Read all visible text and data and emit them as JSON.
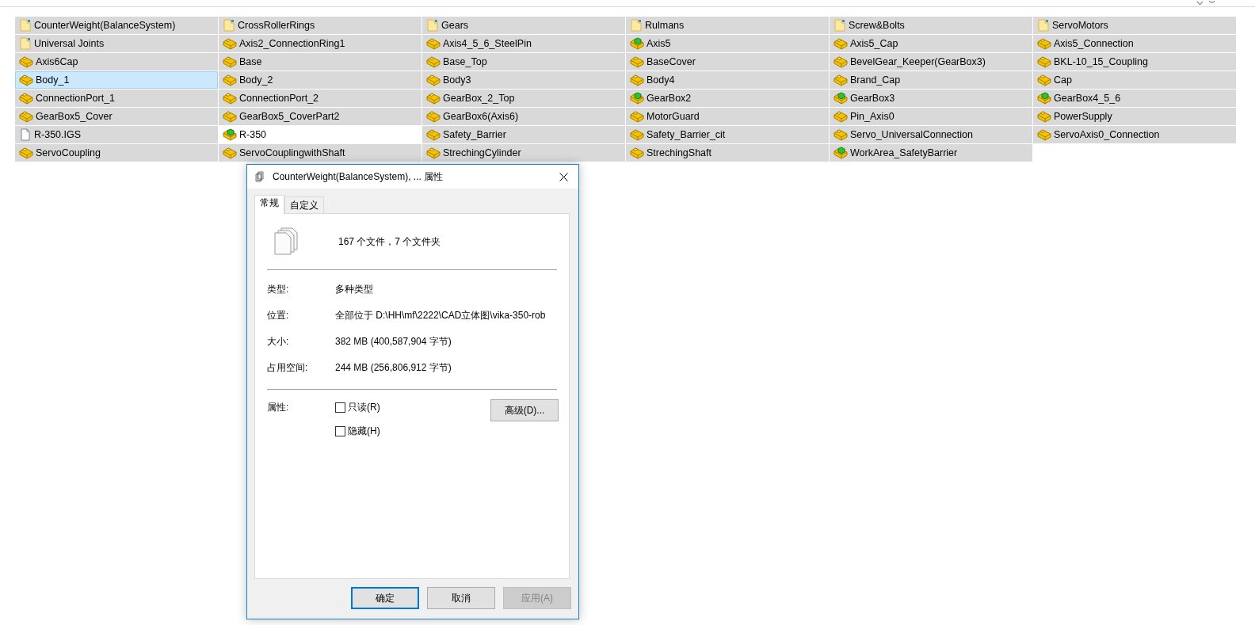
{
  "items": [
    {
      "name": "CounterWeight(BalanceSystem)",
      "kind": "folder",
      "selected": true,
      "hovered": false
    },
    {
      "name": "CrossRollerRings",
      "kind": "folder",
      "selected": true,
      "hovered": false
    },
    {
      "name": "Gears",
      "kind": "folder",
      "selected": true,
      "hovered": false
    },
    {
      "name": "Rulmans",
      "kind": "folder",
      "selected": true,
      "hovered": false
    },
    {
      "name": "Screw&Bolts",
      "kind": "folder",
      "selected": true,
      "hovered": false
    },
    {
      "name": "ServoMotors",
      "kind": "folder",
      "selected": true,
      "hovered": false
    },
    {
      "name": "Universal Joints",
      "kind": "folder",
      "selected": true,
      "hovered": false
    },
    {
      "name": "Axis2_ConnectionRing1",
      "kind": "part",
      "selected": true,
      "hovered": false
    },
    {
      "name": "Axis4_5_6_SteelPin",
      "kind": "part",
      "selected": true,
      "hovered": false
    },
    {
      "name": "Axis5",
      "kind": "assembly",
      "selected": true,
      "hovered": false
    },
    {
      "name": "Axis5_Cap",
      "kind": "part",
      "selected": true,
      "hovered": false
    },
    {
      "name": "Axis5_Connection",
      "kind": "part",
      "selected": true,
      "hovered": false
    },
    {
      "name": "Axis6Cap",
      "kind": "part",
      "selected": true,
      "hovered": false
    },
    {
      "name": "Base",
      "kind": "part",
      "selected": true,
      "hovered": false
    },
    {
      "name": "Base_Top",
      "kind": "part",
      "selected": true,
      "hovered": false
    },
    {
      "name": "BaseCover",
      "kind": "part",
      "selected": true,
      "hovered": false
    },
    {
      "name": "BevelGear_Keeper(GearBox3)",
      "kind": "part",
      "selected": true,
      "hovered": false
    },
    {
      "name": "BKL-10_15_Coupling",
      "kind": "part",
      "selected": true,
      "hovered": false
    },
    {
      "name": "Body_1",
      "kind": "part",
      "selected": true,
      "hovered": true
    },
    {
      "name": "Body_2",
      "kind": "part",
      "selected": true,
      "hovered": false
    },
    {
      "name": "Body3",
      "kind": "part",
      "selected": true,
      "hovered": false
    },
    {
      "name": "Body4",
      "kind": "part",
      "selected": true,
      "hovered": false
    },
    {
      "name": "Brand_Cap",
      "kind": "part",
      "selected": true,
      "hovered": false
    },
    {
      "name": "Cap",
      "kind": "part",
      "selected": true,
      "hovered": false
    },
    {
      "name": "ConnectionPort_1",
      "kind": "part",
      "selected": true,
      "hovered": false
    },
    {
      "name": "ConnectionPort_2",
      "kind": "part",
      "selected": true,
      "hovered": false
    },
    {
      "name": "GearBox_2_Top",
      "kind": "part",
      "selected": true,
      "hovered": false
    },
    {
      "name": "GearBox2",
      "kind": "assembly",
      "selected": true,
      "hovered": false
    },
    {
      "name": "GearBox3",
      "kind": "assembly",
      "selected": true,
      "hovered": false
    },
    {
      "name": "GearBox4_5_6",
      "kind": "assembly",
      "selected": true,
      "hovered": false
    },
    {
      "name": "GearBox5_Cover",
      "kind": "part",
      "selected": true,
      "hovered": false
    },
    {
      "name": "GearBox5_CoverPart2",
      "kind": "part",
      "selected": true,
      "hovered": false
    },
    {
      "name": "GearBox6(Axis6)",
      "kind": "part",
      "selected": true,
      "hovered": false
    },
    {
      "name": "MotorGuard",
      "kind": "part",
      "selected": true,
      "hovered": false
    },
    {
      "name": "Pin_Axis0",
      "kind": "part",
      "selected": true,
      "hovered": false
    },
    {
      "name": "PowerSupply",
      "kind": "part",
      "selected": true,
      "hovered": false
    },
    {
      "name": "R-350.IGS",
      "kind": "file",
      "selected": true,
      "hovered": false
    },
    {
      "name": "R-350",
      "kind": "assembly",
      "selected": false,
      "hovered": false
    },
    {
      "name": "Safety_Barrier",
      "kind": "part",
      "selected": true,
      "hovered": false
    },
    {
      "name": "Safety_Barrier_cit",
      "kind": "part",
      "selected": true,
      "hovered": false
    },
    {
      "name": "Servo_UniversalConnection",
      "kind": "part",
      "selected": true,
      "hovered": false
    },
    {
      "name": "ServoAxis0_Connection",
      "kind": "part",
      "selected": true,
      "hovered": false
    },
    {
      "name": "ServoCoupling",
      "kind": "part",
      "selected": true,
      "hovered": false
    },
    {
      "name": "ServoCouplingwithShaft",
      "kind": "part",
      "selected": true,
      "hovered": false
    },
    {
      "name": "StrechingCylinder",
      "kind": "part",
      "selected": true,
      "hovered": false
    },
    {
      "name": "StrechingShaft",
      "kind": "part",
      "selected": true,
      "hovered": false
    },
    {
      "name": "WorkArea_SafetyBarrier",
      "kind": "assembly",
      "selected": true,
      "hovered": false
    }
  ],
  "dialog": {
    "title": "CounterWeight(BalanceSystem), ... 属性",
    "tabs": [
      {
        "label": "常规",
        "selected": true
      },
      {
        "label": "自定义",
        "selected": false
      }
    ],
    "summary": "167 个文件，7 个文件夹",
    "fields": [
      {
        "label": "类型:",
        "value": "多种类型"
      },
      {
        "label": "位置:",
        "value": "全部位于 D:\\HH\\mf\\2222\\CAD立体图\\vika-350-rob"
      },
      {
        "label": "大小:",
        "value": "382 MB (400,587,904 字节)"
      },
      {
        "label": "占用空间:",
        "value": "244 MB (256,806,912 字节)"
      }
    ],
    "attributes": {
      "label": "属性:",
      "checkboxes": [
        {
          "label": "只读(R)",
          "checked": false
        },
        {
          "label": "隐藏(H)",
          "checked": false
        }
      ],
      "advanced_button": "高级(D)..."
    },
    "buttons": [
      {
        "label": "确定",
        "default": true,
        "disabled": false
      },
      {
        "label": "取消",
        "default": false,
        "disabled": false
      },
      {
        "label": "应用(A)",
        "default": false,
        "disabled": true
      }
    ]
  }
}
